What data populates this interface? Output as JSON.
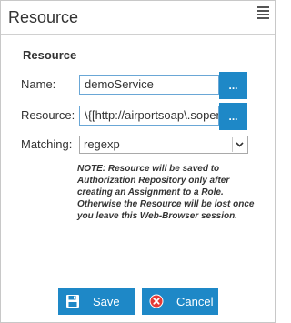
{
  "header": {
    "title": "Resource",
    "menu_icon": "hamburger-menu-icon"
  },
  "form": {
    "section_title": "Resource",
    "name": {
      "label": "Name:",
      "value": "demoService",
      "browse_label": "..."
    },
    "resource": {
      "label": "Resource:",
      "value": "\\{[http://airportsoap\\.sopera",
      "browse_label": "..."
    },
    "matching": {
      "label": "Matching:",
      "selected": "regexp"
    },
    "note": "NOTE: Resource will be saved to Authorization Repository only after creating an Assignment to a Role. Otherwise the Resource will be lost once you leave this Web-Browser session."
  },
  "actions": {
    "save_label": "Save",
    "cancel_label": "Cancel",
    "save_icon": "floppy-disk-icon",
    "cancel_icon": "close-circle-icon"
  },
  "colors": {
    "accent": "#1e88c7",
    "input_border": "#6aa7d6",
    "cancel_red": "#e53935"
  }
}
